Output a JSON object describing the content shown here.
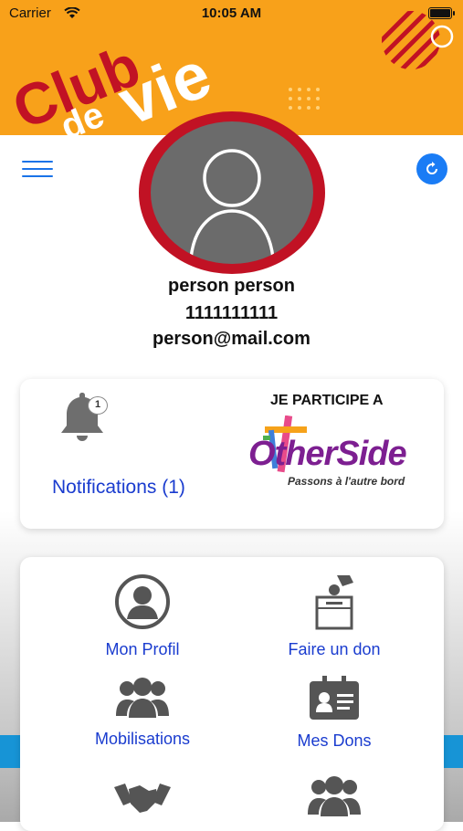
{
  "status_bar": {
    "carrier": "Carrier",
    "time": "10:05 AM"
  },
  "header": {
    "logo": {
      "word1": "Club",
      "word2": "de",
      "word3": "vie"
    },
    "brand_colors": {
      "orange": "#f8a11a",
      "red": "#c11224",
      "white": "#ffffff"
    }
  },
  "toolbar": {
    "menu_icon": "hamburger-icon",
    "refresh_icon": "refresh-icon",
    "accent": "#1a7cf5"
  },
  "profile": {
    "avatar_icon": "user-avatar-icon",
    "name": "person person",
    "phone": "1111111111",
    "email": "person@mail.com"
  },
  "notifications": {
    "icon": "bell-icon",
    "badge_count": "1",
    "link_label": "Notifications (1)"
  },
  "participation": {
    "heading": "JE PARTICIPE A",
    "logo_text": "OtherSide",
    "tagline": "Passons à l'autre bord"
  },
  "menu_grid": [
    {
      "label": "Mon Profil",
      "icon": "profile-icon"
    },
    {
      "label": "Faire un don",
      "icon": "donation-box-icon"
    },
    {
      "label": "Mobilisations",
      "icon": "group-icon"
    },
    {
      "label": "Mes Dons",
      "icon": "id-card-icon"
    },
    {
      "label": "",
      "icon": "handshake-icon"
    },
    {
      "label": "",
      "icon": "group-icon"
    }
  ]
}
